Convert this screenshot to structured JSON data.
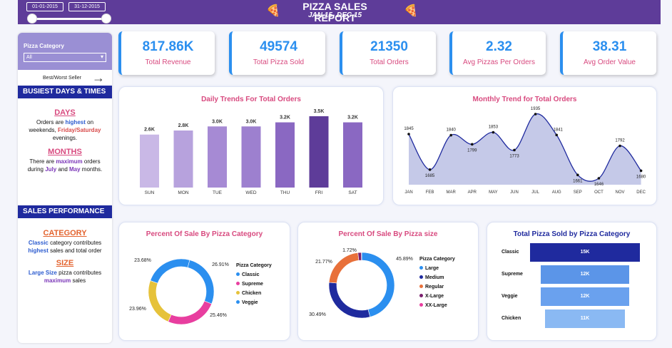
{
  "header": {
    "title": "PIZZA SALES REPORT",
    "subtitle": "JAN 15- DEC 15",
    "date_from": "01-01-2015",
    "date_to": "31-12-2015",
    "pizza_icon": "🍕",
    "bg_color": "#5e3c99"
  },
  "sidebar": {
    "slicer_label": "Pizza Category",
    "slicer_value": "All",
    "slicer_chevron": "▾",
    "best_worst": "Best/Worst Seller",
    "arrow": "→",
    "busiest_title": "BUSIEST DAYS & TIMES",
    "days_heading": "DAYS",
    "days_p1": "Orders are ",
    "days_highest": "highest",
    "days_p2": " on weekends, ",
    "days_fs": "Friday/Saturday",
    "days_p3": " evenings.",
    "months_heading": "MONTHS",
    "months_p1": "There are ",
    "months_max": "maximum",
    "months_p2": " orders during ",
    "months_july": "July",
    "months_and": " and ",
    "months_may": "May",
    "months_p3": " months.",
    "sales_title": "SALES PERFORMANCE",
    "category_heading": "CATEGORY",
    "cat_classic": "Classic",
    "cat_p1": " category contributes ",
    "cat_highest": "highest",
    "cat_p2": " sales and total order",
    "size_heading": "SIZE",
    "size_large": "Large Size",
    "size_p1": " pizza contributes ",
    "size_max": "maximum",
    "size_p2": " sales"
  },
  "kpis": [
    {
      "value": "817.86K",
      "label": "Total Revenue"
    },
    {
      "value": "49574",
      "label": "Total Pizza Sold"
    },
    {
      "value": "21350",
      "label": "Total Orders"
    },
    {
      "value": "2.32",
      "label": "Avg Pizzas Per Orders"
    },
    {
      "value": "38.31",
      "label": "Avg Order Value"
    }
  ],
  "chart_data": [
    {
      "type": "bar",
      "title": "Daily Trends For Total Orders",
      "categories": [
        "SUN",
        "MON",
        "TUE",
        "WED",
        "THU",
        "FRI",
        "SAT"
      ],
      "values": [
        2.6,
        2.8,
        3.0,
        3.0,
        3.2,
        3.5,
        3.2
      ],
      "labels": [
        "2.6K",
        "2.8K",
        "3.0K",
        "3.0K",
        "3.2K",
        "3.5K",
        "3.2K"
      ],
      "colors": [
        "#c9b8e6",
        "#b7a2dd",
        "#a68ad4",
        "#9d80cf",
        "#8a68c2",
        "#5e3c99",
        "#8a68c2"
      ]
    },
    {
      "type": "area",
      "title": "Monthly Trend for Total Orders",
      "categories": [
        "JAN",
        "FEB",
        "MAR",
        "APR",
        "MAY",
        "JUN",
        "JUL",
        "AUG",
        "SEP",
        "OCT",
        "NOV",
        "DEC"
      ],
      "values": [
        1845,
        1685,
        1840,
        1799,
        1853,
        1773,
        1935,
        1841,
        1661,
        1646,
        1792,
        1680
      ],
      "fill": "#c5c9e8",
      "line": "#1f2a9e"
    },
    {
      "type": "pie",
      "title": "Percent Of Sale By Pizza Category",
      "legend_title": "Pizza Category",
      "slices": [
        {
          "name": "Classic",
          "value": 26.91,
          "label": "26.91%",
          "color": "#2b8fef"
        },
        {
          "name": "Supreme",
          "value": 25.46,
          "label": "25.46%",
          "color": "#e83e9f"
        },
        {
          "name": "Chicken",
          "value": 23.96,
          "label": "23.96%",
          "color": "#e6c23a"
        },
        {
          "name": "Veggie",
          "value": 23.68,
          "label": "23.68%",
          "color": "#2b8fef"
        }
      ]
    },
    {
      "type": "pie",
      "title": "Percent Of Sale By Pizza size",
      "legend_title": "Pizza Category",
      "slices": [
        {
          "name": "Large",
          "value": 45.89,
          "label": "45.89%",
          "color": "#2b8fef"
        },
        {
          "name": "Medium",
          "value": 30.49,
          "label": "30.49%",
          "color": "#1f2a9e"
        },
        {
          "name": "Regular",
          "value": 21.77,
          "label": "21.77%",
          "color": "#e8703a"
        },
        {
          "name": "X-Large",
          "value": 1.72,
          "label": "1.72%",
          "color": "#7a1f6e"
        },
        {
          "name": "XX-Large",
          "value": 0.12,
          "label": "",
          "color": "#e83e9f"
        }
      ]
    },
    {
      "type": "bar",
      "title": "Total Pizza Sold by Pizza Category",
      "categories": [
        "Classic",
        "Supreme",
        "Veggie",
        "Chicken"
      ],
      "values": [
        15,
        12,
        12,
        11
      ],
      "labels": [
        "15K",
        "12K",
        "12K",
        "11K"
      ],
      "colors": [
        "#1f2a9e",
        "#5b95e8",
        "#6aa1ee",
        "#8ab9f3"
      ]
    }
  ]
}
